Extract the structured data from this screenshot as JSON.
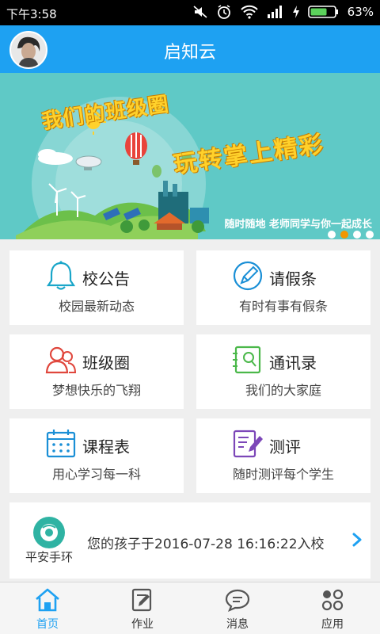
{
  "status": {
    "time": "下午3:58",
    "battery_percent": "63%"
  },
  "header": {
    "title": "启知云"
  },
  "banner": {
    "headline1": "我们的班级圈",
    "headline2": "玩转掌上精彩",
    "caption": "随时随地 老师同学与你一起成长",
    "active_slide_index": 1
  },
  "cards": [
    {
      "title": "校公告",
      "subtitle": "校园最新动态",
      "icon": "bell-icon"
    },
    {
      "title": "请假条",
      "subtitle": "有时有事有假条",
      "icon": "pencil-circle-icon"
    },
    {
      "title": "班级圈",
      "subtitle": "梦想快乐的飞翔",
      "icon": "people-icon"
    },
    {
      "title": "通讯录",
      "subtitle": "我们的大家庭",
      "icon": "contacts-icon"
    },
    {
      "title": "课程表",
      "subtitle": "用心学习每一科",
      "icon": "calendar-icon"
    },
    {
      "title": "测评",
      "subtitle": "随时测评每个学生",
      "icon": "evaluation-icon"
    }
  ],
  "bracelet": {
    "label": "平安手环",
    "message": "您的孩子于2016-07-28 16:16:22入校"
  },
  "nav": [
    {
      "label": "首页",
      "icon": "home-icon",
      "active": true
    },
    {
      "label": "作业",
      "icon": "homework-icon",
      "active": false
    },
    {
      "label": "消息",
      "icon": "message-icon",
      "active": false
    },
    {
      "label": "应用",
      "icon": "apps-icon",
      "active": false
    }
  ],
  "colors": {
    "primary": "#1ea1f2",
    "accent_orange": "#f39700",
    "banner_bg": "#5fc9c6"
  }
}
